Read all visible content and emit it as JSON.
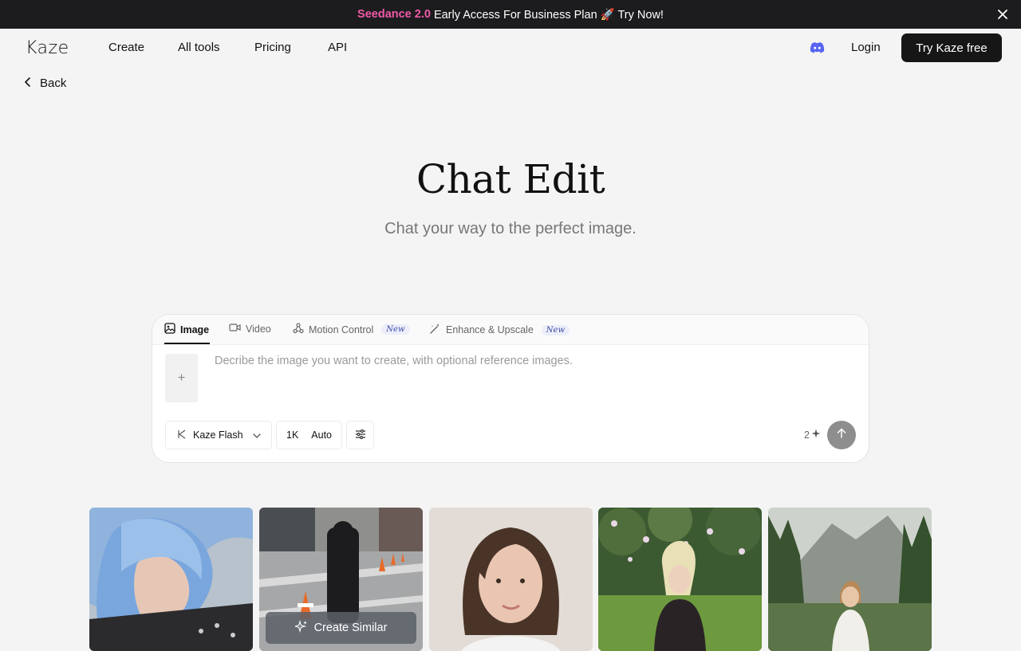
{
  "banner": {
    "highlight": "Seedance 2.0",
    "text": "Early Access For Business Plan 🚀 Try Now!",
    "highlight_color": "#f05aa8"
  },
  "nav": {
    "logo": "Kaze",
    "links": [
      "Create",
      "All tools",
      "Pricing",
      "API"
    ],
    "discord_icon": "discord-icon",
    "login": "Login",
    "cta": "Try Kaze free"
  },
  "back": {
    "label": "Back"
  },
  "hero": {
    "title": "Chat Edit",
    "subtitle": "Chat your way to the perfect image."
  },
  "composer": {
    "tabs": [
      {
        "label": "Image",
        "icon": "image-icon",
        "active": true
      },
      {
        "label": "Video",
        "icon": "video-icon"
      },
      {
        "label": "Motion Control",
        "icon": "motion-icon",
        "badge": "New"
      },
      {
        "label": "Enhance & Upscale",
        "icon": "magic-wand-icon",
        "badge": "New"
      }
    ],
    "placeholder": "Decribe the image you want to create, with optional reference images.",
    "model": "Kaze Flash",
    "resolution": "1K",
    "aspect": "Auto",
    "credits": "2"
  },
  "gallery": {
    "hover_label": "Create Similar"
  }
}
